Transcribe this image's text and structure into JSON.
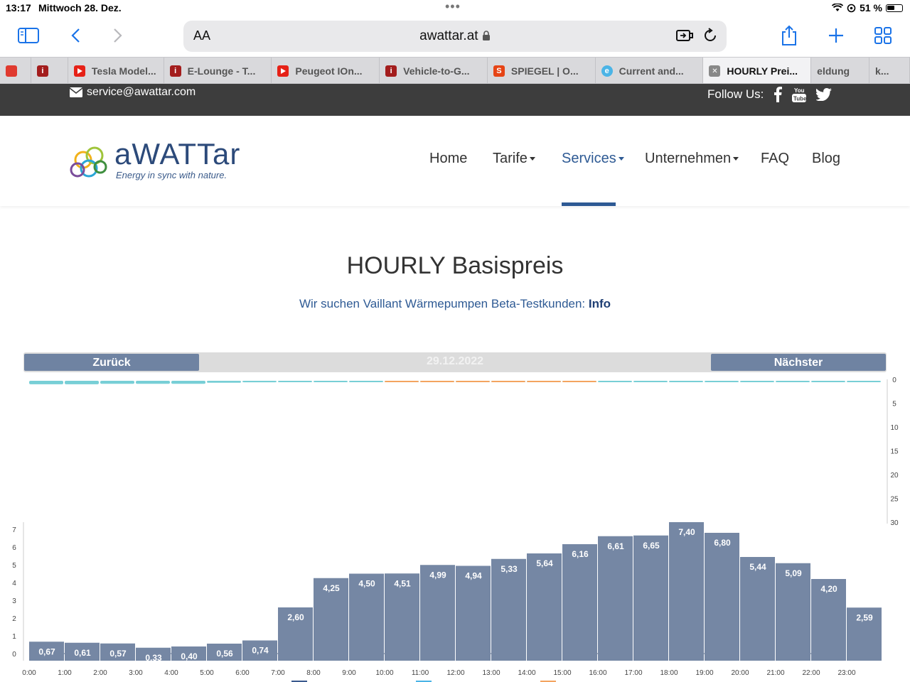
{
  "status_bar": {
    "time": "13:17",
    "date": "Mittwoch 28. Dez.",
    "battery": "51 %"
  },
  "browser": {
    "aa_label": "AA",
    "url": "awattar.at",
    "tabs": [
      {
        "label": "",
        "icon": "red-square-icon",
        "color": "#e03a2f"
      },
      {
        "label": "",
        "icon": "info-icon",
        "color": "#a31d1d"
      },
      {
        "label": "Tesla Model...",
        "icon": "youtube-icon",
        "color": "#e62117"
      },
      {
        "label": "E-Lounge - T...",
        "icon": "info-icon",
        "color": "#a31d1d"
      },
      {
        "label": "Peugeot IOn...",
        "icon": "youtube-icon",
        "color": "#e62117"
      },
      {
        "label": "Vehicle-to-G...",
        "icon": "info-icon",
        "color": "#a31d1d"
      },
      {
        "label": "SPIEGEL | O...",
        "icon": "spiegel-icon",
        "color": "#e64415"
      },
      {
        "label": "Current and...",
        "icon": "globe-icon",
        "color": "#4bb4e6"
      },
      {
        "label": "HOURLY Prei...",
        "icon": "close-icon",
        "color": "#888888",
        "active": true
      },
      {
        "label": "eldung",
        "icon": "",
        "color": ""
      },
      {
        "label": "k...",
        "icon": "",
        "color": ""
      }
    ]
  },
  "site": {
    "email": "service@awattar.com",
    "follow_label": "Follow Us:",
    "logo_word": "aWATTar",
    "logo_tagline": "Energy in sync with nature.",
    "nav": [
      {
        "label": "Home",
        "dropdown": false
      },
      {
        "label": "Tarife",
        "dropdown": true
      },
      {
        "label": "Services",
        "dropdown": true,
        "active": true
      },
      {
        "label": "Unternehmen",
        "dropdown": true
      },
      {
        "label": "FAQ",
        "dropdown": false
      },
      {
        "label": "Blog",
        "dropdown": false
      }
    ],
    "title": "HOURLY Basispreis",
    "subtitle_text": "Wir suchen Vaillant Wärmepumpen Beta-Testkunden: ",
    "subtitle_link": "Info",
    "date_nav": {
      "prev": "Zurück",
      "date": "29.12.2022",
      "next": "Nächster"
    }
  },
  "chart_data": {
    "type": "bar",
    "categories": [
      "0:00",
      "1:00",
      "2:00",
      "3:00",
      "4:00",
      "5:00",
      "6:00",
      "7:00",
      "8:00",
      "9:00",
      "10:00",
      "11:00",
      "12:00",
      "13:00",
      "14:00",
      "15:00",
      "16:00",
      "17:00",
      "18:00",
      "19:00",
      "20:00",
      "21:00",
      "22:00",
      "23:00"
    ],
    "values": [
      0.67,
      0.61,
      0.57,
      0.33,
      0.4,
      0.56,
      0.74,
      2.6,
      4.25,
      4.5,
      4.51,
      4.99,
      4.94,
      5.33,
      5.64,
      6.16,
      6.61,
      6.65,
      7.4,
      6.8,
      5.44,
      5.09,
      4.2,
      2.59
    ],
    "value_labels": [
      "0,67",
      "0,61",
      "0,57",
      "0,33",
      "0,40",
      "0,56",
      "0,74",
      "2,60",
      "4,25",
      "4,50",
      "4,51",
      "4,99",
      "4,94",
      "5,33",
      "5,64",
      "6,16",
      "6,61",
      "6,65",
      "7,40",
      "6,80",
      "5,44",
      "5,09",
      "4,20",
      "2,59"
    ],
    "ylim": [
      0,
      7.4
    ],
    "y_ticks": [
      0,
      1,
      2,
      3,
      4,
      5,
      6,
      7
    ],
    "bar_color": "#7587a4",
    "secondary_axis": {
      "ticks": [
        0,
        5,
        10,
        15,
        20,
        25,
        30
      ],
      "orientation": "inverted",
      "series": [
        {
          "color": "#78cfd6",
          "values": [
            0.35,
            0.35,
            0.3,
            0.3,
            0.3,
            0.2,
            0.15,
            0.1,
            0.1,
            0.1,
            0.1,
            0.1,
            0.1,
            0.1,
            0.1,
            0.1,
            0.1,
            0.1,
            0.1,
            0.1,
            0.1,
            0.1,
            0.1,
            0.1
          ]
        },
        {
          "color": "#f4a460",
          "values": [
            0,
            0,
            0,
            0,
            0,
            0,
            0,
            0,
            0,
            0,
            0.05,
            0.05,
            0.05,
            0.05,
            0.05,
            0.05,
            0,
            0,
            0,
            0,
            0,
            0,
            0,
            0
          ]
        }
      ]
    }
  }
}
